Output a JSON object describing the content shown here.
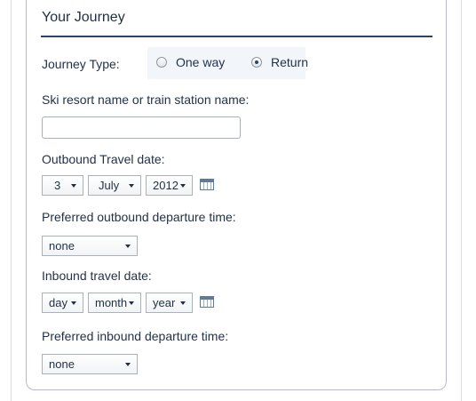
{
  "section": {
    "title": "Your Journey"
  },
  "journey_type": {
    "label": "Journey Type:",
    "options": [
      {
        "label": "One way",
        "checked": false
      },
      {
        "label": "Return",
        "checked": true
      }
    ]
  },
  "destination": {
    "label": "Ski resort name or train station name:",
    "value": ""
  },
  "outbound_date": {
    "label": "Outbound Travel date:",
    "day": "3",
    "month": "July",
    "year": "2012"
  },
  "outbound_time": {
    "label": "Preferred outbound departure time:",
    "value": "none"
  },
  "inbound_date": {
    "label": "Inbound travel date:",
    "day": "day",
    "month": "month",
    "year": "year"
  },
  "inbound_time": {
    "label": "Preferred inbound departure time:",
    "value": "none"
  },
  "icons": {
    "calendar": "calendar-icon"
  }
}
